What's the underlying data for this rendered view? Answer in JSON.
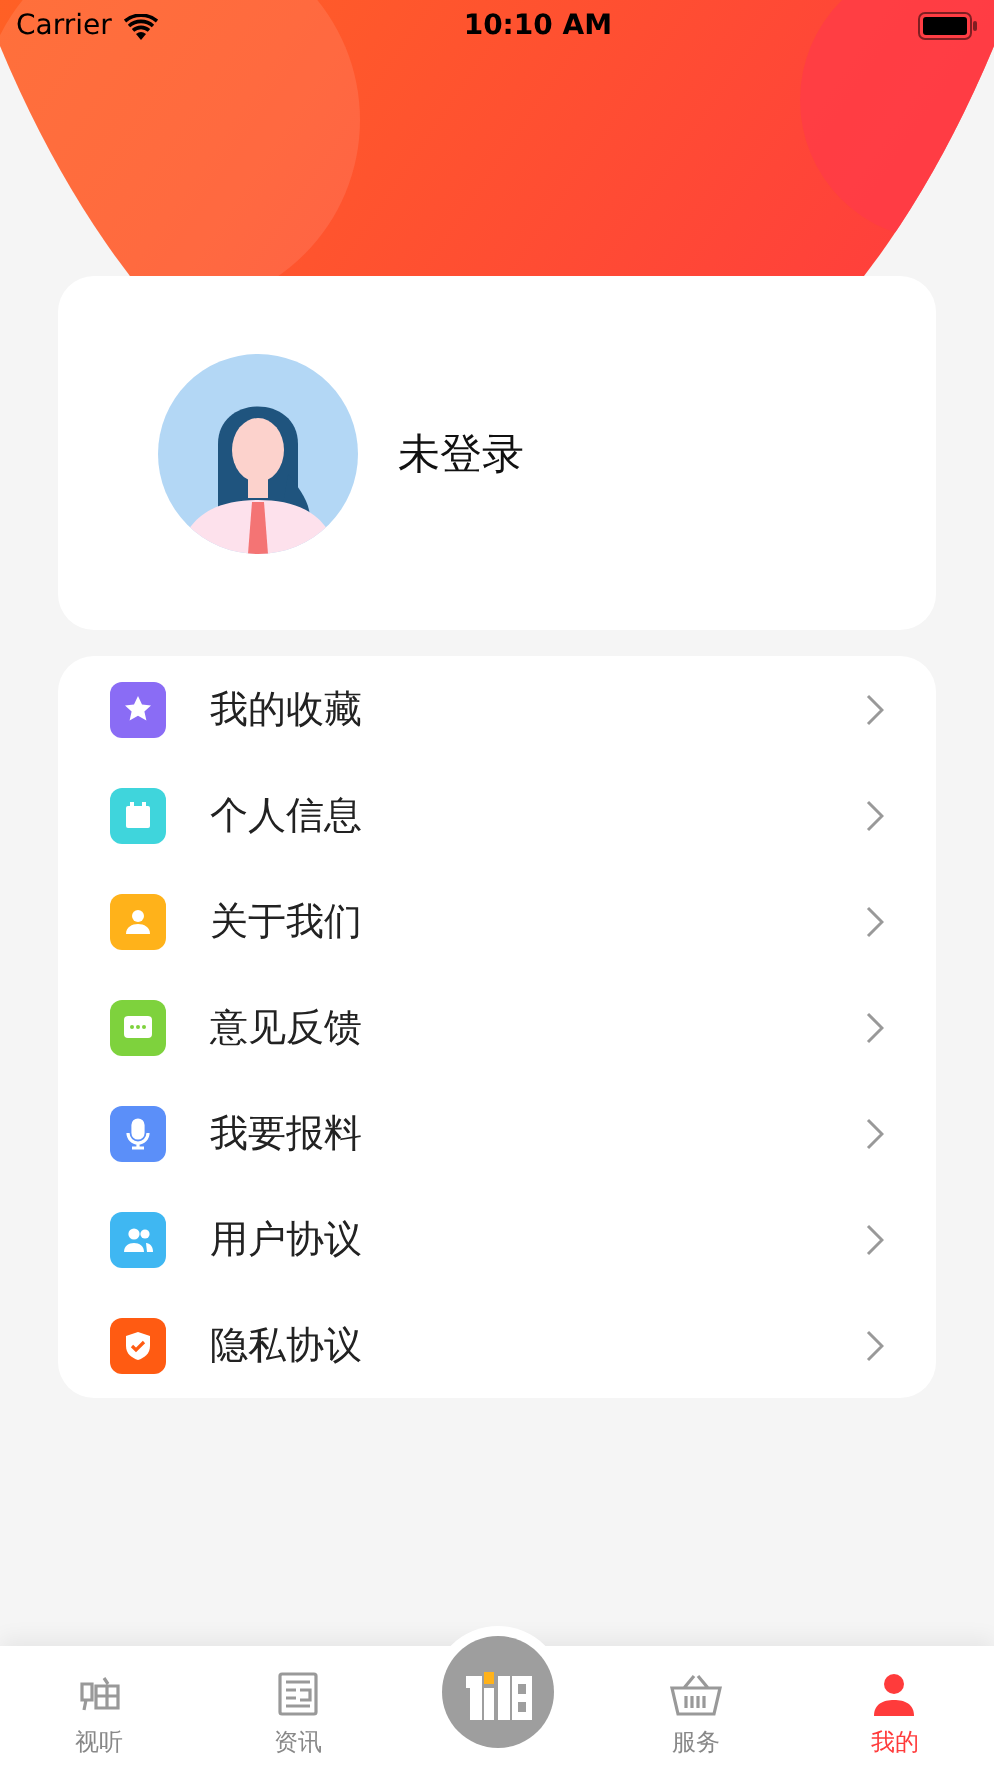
{
  "status_bar": {
    "carrier": "Carrier",
    "time": "10:10 AM"
  },
  "profile": {
    "name": "未登录"
  },
  "menu": [
    {
      "label": "我的收藏",
      "kind": "star",
      "color": "#8a6cf5"
    },
    {
      "label": "个人信息",
      "kind": "card",
      "color": "#3fd5dc"
    },
    {
      "label": "关于我们",
      "kind": "person",
      "color": "#ffb21a"
    },
    {
      "label": "意见反馈",
      "kind": "chat",
      "color": "#7ed23d"
    },
    {
      "label": "我要报料",
      "kind": "mic",
      "color": "#5b8ff9"
    },
    {
      "label": "用户协议",
      "kind": "users",
      "color": "#3fb7f2"
    },
    {
      "label": "隐私协议",
      "kind": "shield",
      "color": "#ff5b12"
    }
  ],
  "tabs": [
    {
      "label": "视听",
      "kind": "hi",
      "selected": false
    },
    {
      "label": "资讯",
      "kind": "news",
      "selected": false
    },
    {
      "kind": "logo",
      "selected": false
    },
    {
      "label": "服务",
      "kind": "basket",
      "selected": false
    },
    {
      "label": "我的",
      "kind": "me",
      "selected": true
    }
  ]
}
